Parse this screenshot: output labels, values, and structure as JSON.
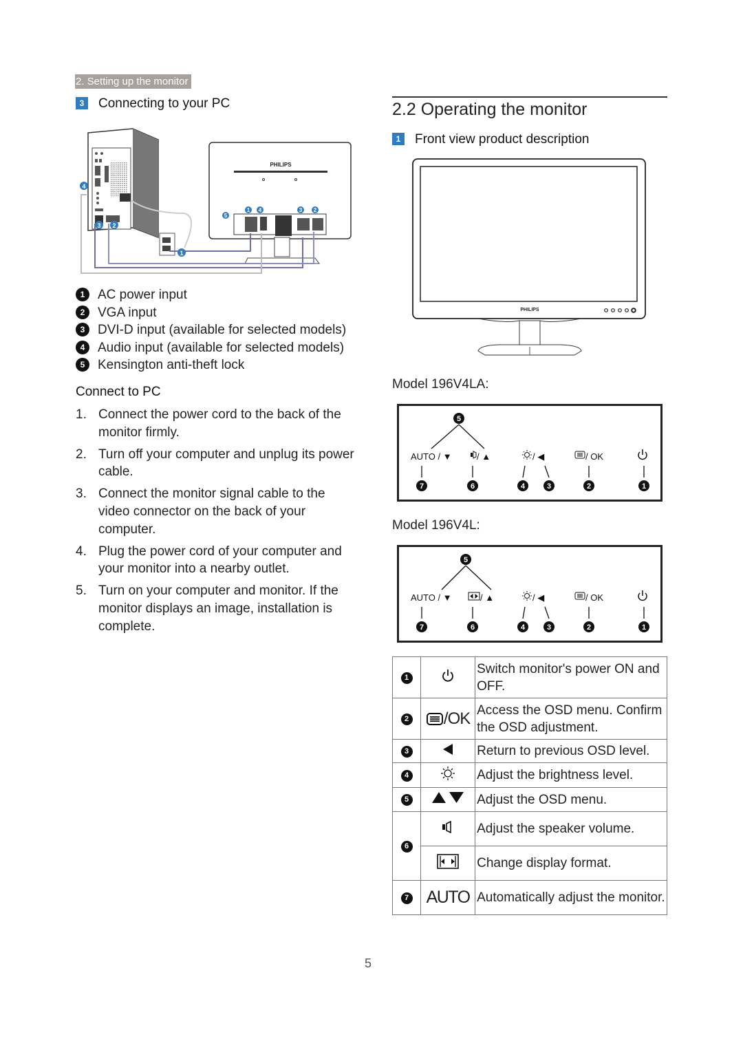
{
  "breadcrumb": "2. Setting up the monitor",
  "left": {
    "section": {
      "badge": "3",
      "title": "Connecting to your PC"
    },
    "diagram": {
      "brand": "PHILIPS",
      "callouts": [
        "1",
        "2",
        "3",
        "4",
        "5"
      ]
    },
    "legend": [
      {
        "num": "1",
        "text": "AC power input"
      },
      {
        "num": "2",
        "text": "VGA input"
      },
      {
        "num": "3",
        "text": "DVI-D input (available for selected models)"
      },
      {
        "num": "4",
        "text": "Audio input (available for selected models)"
      },
      {
        "num": "5",
        "text": "Kensington anti-theft lock"
      }
    ],
    "connect_heading": "Connect to PC",
    "steps": [
      {
        "num": "1.",
        "text": "Connect the power cord to the back of the monitor firmly."
      },
      {
        "num": "2.",
        "text": "Turn off your computer and unplug its power cable."
      },
      {
        "num": "3.",
        "text": "Connect the monitor signal cable to the video connector on the back of your computer."
      },
      {
        "num": "4.",
        "text": "Plug the power cord of your computer and your monitor into a nearby outlet."
      },
      {
        "num": "5.",
        "text": "Turn on your computer and monitor. If the monitor displays an image,  installation is complete."
      }
    ]
  },
  "right": {
    "section_title": "2.2  Operating the monitor",
    "subsection": {
      "badge": "1",
      "title": "Front view product description"
    },
    "front_brand": "PHILIPS",
    "models": [
      {
        "label": "Model 196V4LA:",
        "controls": [
          {
            "text": "AUTO / ▼",
            "icon": "auto-down-icon",
            "callouts": [
              "7"
            ]
          },
          {
            "text": "/ ▲",
            "icon": "speaker-icon",
            "callouts": [
              "6"
            ]
          },
          {
            "text": "/ ◀",
            "icon": "brightness-icon",
            "callouts": [
              "4",
              "3"
            ]
          },
          {
            "text": "/ OK",
            "icon": "menu-icon",
            "callouts": [
              "2"
            ]
          },
          {
            "text": "",
            "icon": "power-icon",
            "callouts": [
              "1"
            ]
          }
        ],
        "top_callout": "5"
      },
      {
        "label": "Model 196V4L:",
        "controls": [
          {
            "text": "AUTO / ▼",
            "icon": "auto-down-icon",
            "callouts": [
              "7"
            ]
          },
          {
            "text": "/ ▲",
            "icon": "display-format-icon",
            "callouts": [
              "6"
            ]
          },
          {
            "text": "/ ◀",
            "icon": "brightness-icon",
            "callouts": [
              "4",
              "3"
            ]
          },
          {
            "text": "/ OK",
            "icon": "menu-icon",
            "callouts": [
              "2"
            ]
          },
          {
            "text": "",
            "icon": "power-icon",
            "callouts": [
              "1"
            ]
          }
        ],
        "top_callout": "5"
      }
    ],
    "function_table": [
      {
        "num": "1",
        "icon": "power-icon",
        "icon_text": "",
        "desc": "Switch monitor's power ON and OFF."
      },
      {
        "num": "2",
        "icon": "menu-icon",
        "icon_text": "/OK",
        "desc": "Access the OSD menu. Confirm the OSD adjustment."
      },
      {
        "num": "3",
        "icon": "left-arrow-icon",
        "icon_text": "",
        "desc": "Return to previous OSD level."
      },
      {
        "num": "4",
        "icon": "brightness-icon",
        "icon_text": "",
        "desc": "Adjust the brightness level."
      },
      {
        "num": "5",
        "icon": "up-down-arrows-icon",
        "icon_text": "",
        "desc": "Adjust the OSD menu."
      },
      {
        "num": "6",
        "icon": "speaker-icon",
        "icon_text": "",
        "desc": "Adjust the speaker volume."
      },
      {
        "num": "",
        "icon": "display-format-icon",
        "icon_text": "",
        "desc": "Change display format."
      },
      {
        "num": "7",
        "icon": "auto-icon",
        "icon_text": "AUTO",
        "desc": "Automatically adjust the monitor."
      }
    ]
  },
  "page_number": "5",
  "colors": {
    "badge_blue": "#2f7cbf",
    "breadcrumb_bg": "#a7a09c",
    "text": "#222222"
  }
}
